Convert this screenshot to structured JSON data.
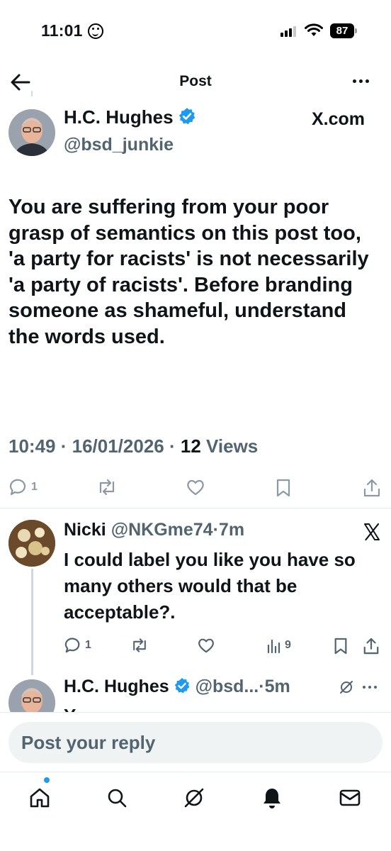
{
  "status_bar": {
    "time": "11:01",
    "battery": "87"
  },
  "header": {
    "title": "Post"
  },
  "post": {
    "author_name": "H.C. Hughes",
    "author_handle": "@bsd_junkie",
    "source": "X.com",
    "text": "You are suffering from your poor grasp of semantics on this post too, 'a party for racists' is not necessarily 'a party of racists'. Before branding someone as shameful, understand the words used.",
    "time": "10:49",
    "date": "16/01/2026",
    "views_count": "12",
    "views_label": "Views",
    "reply_count": "1"
  },
  "reply": {
    "author_name": "Nicki",
    "author_handle": "@NKGme74",
    "time": "7m",
    "text": "I could label you like you have so many others would that be acceptable?.",
    "reply_count": "1",
    "views_count": "9"
  },
  "next_post": {
    "author_name": "H.C. Hughes",
    "author_handle": "@bsd...",
    "time": "5m",
    "text_partial": "Y"
  },
  "composer": {
    "placeholder": "Post your reply"
  },
  "colors": {
    "accent": "#1d9bf0",
    "text": "#0f1419",
    "muted": "#536471",
    "icon": "#8b98a5"
  },
  "tabs": [
    "home-icon",
    "search-icon",
    "grok-icon",
    "notifications-icon",
    "messages-icon"
  ]
}
